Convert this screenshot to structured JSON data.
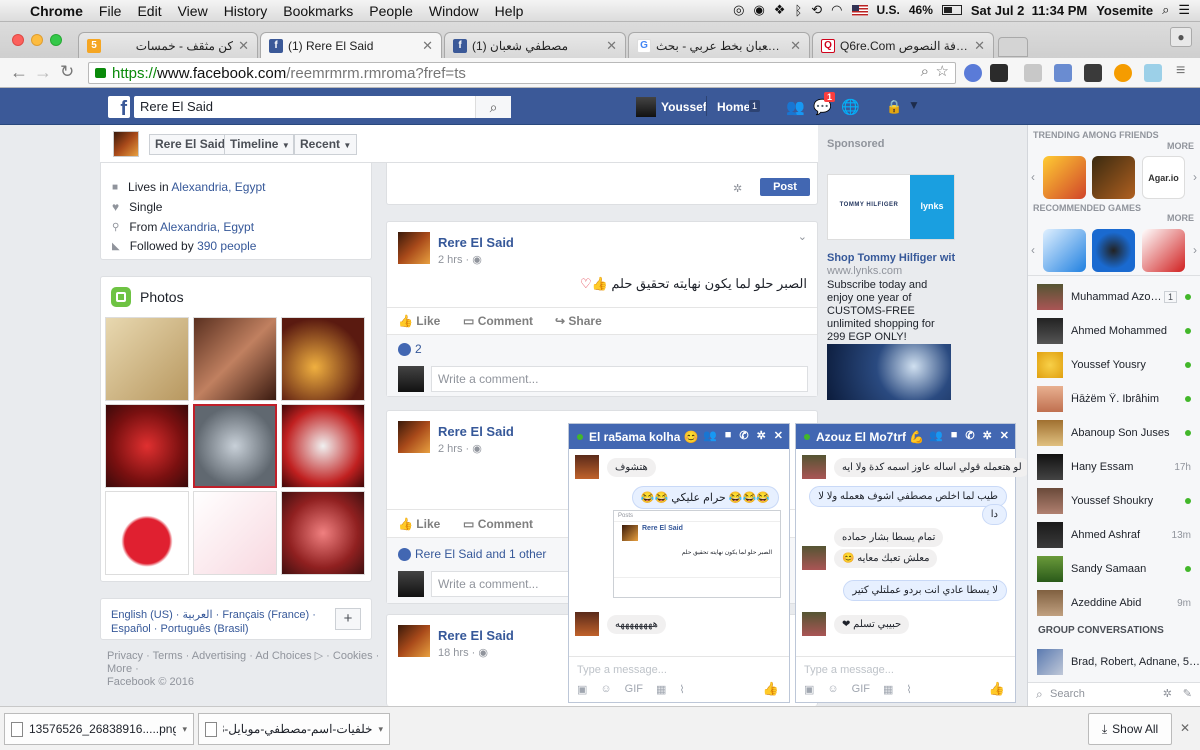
{
  "menubar": {
    "app": "Chrome",
    "menus": [
      "File",
      "Edit",
      "View",
      "History",
      "Bookmarks",
      "People",
      "Window",
      "Help"
    ],
    "input_source": "U.S.",
    "battery": "46%",
    "datetime": "Sat Jul 2  11:34 PM",
    "user": "Yosemite"
  },
  "tabs": [
    {
      "title": "كن مثقف - خمسات",
      "badge": "5",
      "color": "#f5a623"
    },
    {
      "title": "(1) Rere El Said",
      "badge": "f",
      "color": "#3b5998"
    },
    {
      "title": "(1) مصطفي شعبان",
      "badge": "f",
      "color": "#3b5998"
    },
    {
      "title": "اسم شعبان بخط عربي - بحث Google",
      "badge": "G",
      "color": "#4285f4"
    },
    {
      "title": "Q6re.Com زخرفة لزخرفة النصوص",
      "badge": "Q",
      "color": "#d0021b"
    }
  ],
  "address": {
    "scheme": "https://",
    "host": "www.facebook.com",
    "path": "/reemrmrm.rmroma?fref=ts"
  },
  "fb": {
    "search_value": "Rere El Said",
    "user_name": "Youssef",
    "home_label": "Home",
    "home_count": "1",
    "msg_badge": "1"
  },
  "profile_header": {
    "name": "Rere El Said",
    "timeline": "Timeline",
    "recent": "Recent"
  },
  "intro": {
    "lives_prefix": "Lives in ",
    "lives_city": "Alexandria, Egypt",
    "status": "Single",
    "from_prefix": "From ",
    "from_city": "Alexandria, Egypt",
    "followed_prefix": "Followed by ",
    "followed_count": "390 people"
  },
  "photos_title": "Photos",
  "languages": {
    "line1": "English (US) · العربية · Français (France) ·",
    "line2": "Español · Português (Brasil)",
    "add": "+"
  },
  "footer": {
    "line1": "Privacy · Terms · Advertising · Ad Choices ▷ · Cookies ·",
    "line2": "More ·",
    "line3": "Facebook © 2016"
  },
  "composer": {
    "post_button": "Post"
  },
  "posts": [
    {
      "author": "Rere El Said",
      "time": "2 hrs",
      "text": "الصبر حلو لما يكون نهايته تحقيق حلم",
      "like": "Like",
      "comment": "Comment",
      "share": "Share",
      "likes": "2",
      "comment_placeholder": "Write a comment..."
    },
    {
      "author": "Rere El Said",
      "time": "2 hrs",
      "like": "Like",
      "comment": "Comment",
      "likes_text": "Rere El Said and 1 other",
      "comment_placeholder": "Write a comment..."
    },
    {
      "author": "Rere El Said",
      "time": "18 hrs"
    }
  ],
  "sponsored": {
    "label": "Sponsored",
    "brand": "TOMMY HILFIGER",
    "lynks": "lynks",
    "title": "Shop Tommy Hilfiger with ...",
    "url": "www.lynks.com",
    "body": "Subscribe today and enjoy one year of CUSTOMS-FREE unlimited shopping for 299 EGP ONLY!"
  },
  "chat1": {
    "title": "El ra5ama kolha 😊",
    "messages": [
      {
        "dir": "in",
        "text": "هتشوف"
      },
      {
        "dir": "out",
        "text": "😂😂😂 حرام عليكي 😂😂"
      },
      {
        "dir": "in",
        "text": "ههههههههه"
      }
    ],
    "preview": {
      "label": "Posts",
      "name": "Rere El Said",
      "text": "الصبر حلو لما يكون نهايته تحقيق حلم"
    },
    "placeholder": "Type a message..."
  },
  "chat2": {
    "title": "Azouz El Mo7trf 💪",
    "messages": [
      {
        "dir": "in",
        "text": "لو هتعمله قولي اساله عاوز اسمه كدة ولا ايه"
      },
      {
        "dir": "out",
        "text": "طيب لما اخلص مصطفي اشوف هعمله ولا لا"
      },
      {
        "dir": "out",
        "text": "دا"
      },
      {
        "dir": "in",
        "text": "تمام يسطا بشار حماده"
      },
      {
        "dir": "in",
        "text": "معلش تعبك معايه 😊"
      },
      {
        "dir": "out",
        "text": "لا يسطا عادي انت بردو عملتلي كتير"
      },
      {
        "dir": "in",
        "text": "حبيبي تسلم ❤"
      }
    ],
    "placeholder": "Type a message..."
  },
  "sidebar": {
    "trending": "TRENDING AMONG FRIENDS",
    "more": "MORE",
    "recommended": "RECOMMENDED GAMES",
    "more2": "MORE",
    "game_label": "Agar.io",
    "friends": [
      {
        "name": "Muhammad Azou...",
        "extra": "1",
        "kind": "badge"
      },
      {
        "name": "Ahmed Mohammed",
        "kind": "dot"
      },
      {
        "name": "Youssef Yousry",
        "kind": "dot"
      },
      {
        "name": "Ĥāżëm Ŷ. Ibrâĥim",
        "kind": "dot"
      },
      {
        "name": "Abanoup Son Juses",
        "kind": "dot"
      },
      {
        "name": "Hany Essam",
        "extra": "17h",
        "kind": "ago"
      },
      {
        "name": "Youssef Shoukry",
        "kind": "dot"
      },
      {
        "name": "Ahmed Ashraf",
        "extra": "13m",
        "kind": "ago"
      },
      {
        "name": "Sandy Samaan",
        "kind": "dot"
      },
      {
        "name": "Azeddine Abid",
        "extra": "9m",
        "kind": "ago"
      }
    ],
    "group_header": "GROUP CONVERSATIONS",
    "group": "Brad, Robert, Adnane, 55 ...",
    "search_placeholder": "Search"
  },
  "downloads": {
    "file1": "13576526_26838916.....png",
    "file2": "خلفيات-اسم-مصطفي-موبايل-3.jpg",
    "show_all": "Show All"
  },
  "colors": {
    "fb_blue": "#3b5998",
    "chat_blue": "#4267b2",
    "link": "#365899",
    "online": "#42b72a"
  }
}
